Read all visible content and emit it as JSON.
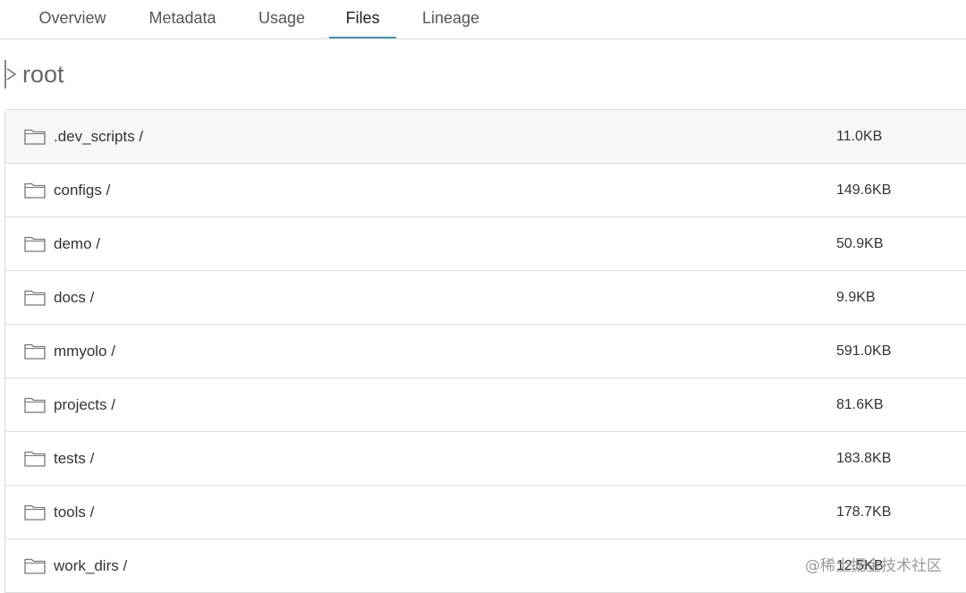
{
  "tabs": [
    {
      "label": "Overview"
    },
    {
      "label": "Metadata"
    },
    {
      "label": "Usage"
    },
    {
      "label": "Files",
      "active": true
    },
    {
      "label": "Lineage"
    }
  ],
  "breadcrumb": {
    "label": "root"
  },
  "files": [
    {
      "name": ".dev_scripts /",
      "size": "11.0KB"
    },
    {
      "name": "configs /",
      "size": "149.6KB"
    },
    {
      "name": "demo /",
      "size": "50.9KB"
    },
    {
      "name": "docs /",
      "size": "9.9KB"
    },
    {
      "name": "mmyolo /",
      "size": "591.0KB"
    },
    {
      "name": "projects /",
      "size": "81.6KB"
    },
    {
      "name": "tests /",
      "size": "183.8KB"
    },
    {
      "name": "tools /",
      "size": "178.7KB"
    },
    {
      "name": "work_dirs /",
      "size": "12.5KB"
    }
  ],
  "watermark": "@稀土掘金技术社区",
  "colors": {
    "active_tab_underline": "#4a90a4",
    "border": "#dcdcdc"
  },
  "icons": {
    "folder": "folder-icon",
    "breadcrumb": "chevron-right-icon"
  }
}
